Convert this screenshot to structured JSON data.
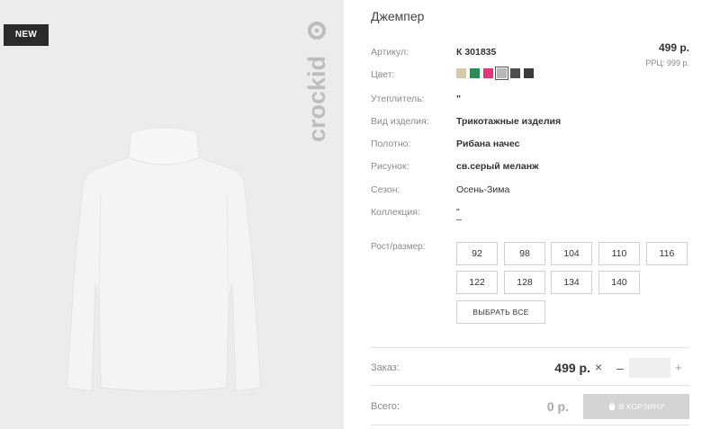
{
  "badge": "NEW",
  "brand": "crockid",
  "title": "Джемпер",
  "price_top": "499 р.",
  "rrp": "РРЦ: 999 р.",
  "attributes": {
    "article": {
      "label": "Артикул:",
      "value": "К 301835"
    },
    "color": {
      "label": "Цвет:"
    },
    "insulation": {
      "label": "Утеплитель:",
      "value": "\""
    },
    "product_type": {
      "label": "Вид изделия:",
      "value": "Трикотажные изделия"
    },
    "fabric": {
      "label": "Полотно:",
      "value": "Рибана начес"
    },
    "pattern": {
      "label": "Рисунок:",
      "value": "св.серый меланж"
    },
    "season": {
      "label": "Сезон:",
      "value": "Осень-Зима"
    },
    "collection": {
      "label": "Коллекция:",
      "value_line1": "\"",
      "value_line2": "–"
    }
  },
  "swatches": [
    "#d7c9a7",
    "#2e8b57",
    "#e6337a",
    "#b8b8b8",
    "#4d4d4d",
    "#3a3a3a"
  ],
  "selected_swatch": 3,
  "sizes_label": "Рост/размер:",
  "sizes": [
    "92",
    "98",
    "104",
    "110",
    "116",
    "122",
    "128",
    "134",
    "140"
  ],
  "select_all": "ВЫБРАТЬ ВСЕ",
  "order": {
    "label": "Заказ:",
    "price": "499 р.",
    "times": "×",
    "minus": "–",
    "plus": "+",
    "quantity": ""
  },
  "total": {
    "label": "Всего:",
    "value": "0 р."
  },
  "cart_button": "В КОРЗИНУ",
  "icons": {
    "cart": "shopping-bag-icon"
  }
}
